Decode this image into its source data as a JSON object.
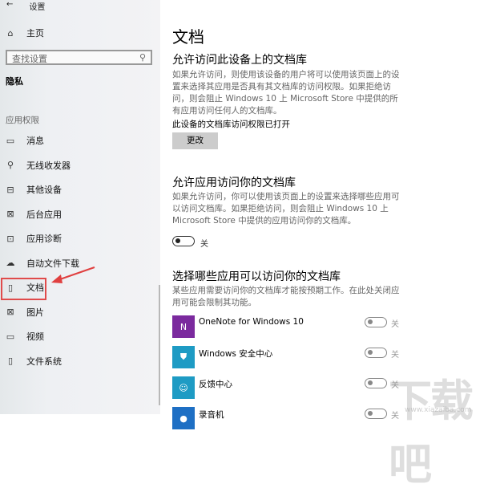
{
  "window": {
    "back": "←",
    "title": "设置"
  },
  "sidebar": {
    "home": "主页",
    "search_placeholder": "查找设置",
    "section": "隐私",
    "group": "应用权限",
    "items": [
      {
        "label": "消息",
        "icon": "▭"
      },
      {
        "label": "无线收发器",
        "icon": "⚲"
      },
      {
        "label": "其他设备",
        "icon": "⊟"
      },
      {
        "label": "后台应用",
        "icon": "⊠"
      },
      {
        "label": "应用诊断",
        "icon": "⊡"
      },
      {
        "label": "自动文件下载",
        "icon": "☁"
      },
      {
        "label": "文档",
        "icon": "▯"
      },
      {
        "label": "图片",
        "icon": "⊠"
      },
      {
        "label": "视频",
        "icon": "▭"
      },
      {
        "label": "文件系统",
        "icon": "▯"
      }
    ]
  },
  "main": {
    "title": "文档",
    "s1": {
      "heading": "允许访问此设备上的文档库",
      "desc": "如果允许访问，则使用该设备的用户将可以使用该页面上的设置来选择其应用是否具有其文档库的访问权限。如果拒绝访问，则会阻止 Windows 10 上 Microsoft Store 中提供的所有应用访问任何人的文档库。",
      "status": "此设备的文档库访问权限已打开",
      "button": "更改"
    },
    "s2": {
      "heading": "允许应用访问你的文档库",
      "desc": "如果允许访问，你可以使用该页面上的设置来选择哪些应用可以访问文档库。如果拒绝访问，则会阻止 Windows 10 上 Microsoft Store 中提供的应用访问你的文档库。",
      "toggle": "关"
    },
    "s3": {
      "heading": "选择哪些应用可以访问你的文档库",
      "desc": "某些应用需要访问你的文档库才能按预期工作。在此处关闭应用可能会限制其功能。"
    },
    "apps": [
      {
        "name": "OneNote for Windows 10",
        "state": "关",
        "color": "#7b2a9e",
        "icon": "N"
      },
      {
        "name": "Windows 安全中心",
        "state": "关",
        "color": "#1e9bc4",
        "icon": "⛊"
      },
      {
        "name": "反馈中心",
        "state": "关",
        "color": "#1e9bc4",
        "icon": "☺"
      },
      {
        "name": "录音机",
        "state": "关",
        "color": "#1e6fc4",
        "icon": "●"
      }
    ]
  },
  "watermark": {
    "text": "下载吧",
    "url": "www.xiazaiba.com"
  }
}
